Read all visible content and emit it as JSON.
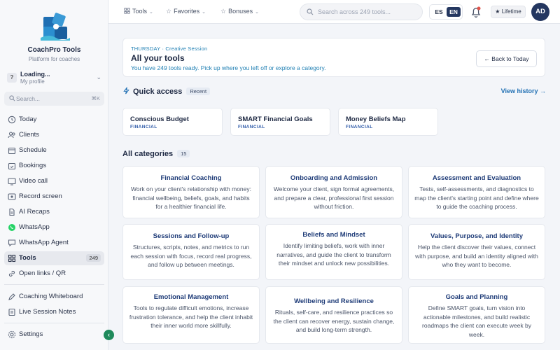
{
  "brand": {
    "name": "CoachPro Tools",
    "tagline": "Platform for coaches"
  },
  "profile": {
    "badge": "?",
    "name": "Loading...",
    "sub": "My profile"
  },
  "sidebar_search": {
    "placeholder": "Search...",
    "shortcut": "⌘K"
  },
  "nav": [
    {
      "label": "Today",
      "icon": "clock-icon"
    },
    {
      "label": "Clients",
      "icon": "users-icon"
    },
    {
      "label": "Schedule",
      "icon": "calendar-icon"
    },
    {
      "label": "Bookings",
      "icon": "calendar-check-icon"
    },
    {
      "label": "Video call",
      "icon": "video-icon"
    },
    {
      "label": "Record screen",
      "icon": "record-icon"
    },
    {
      "label": "AI Recaps",
      "icon": "document-icon"
    },
    {
      "label": "WhatsApp",
      "icon": "whatsapp-icon"
    },
    {
      "label": "WhatsApp Agent",
      "icon": "chat-icon"
    },
    {
      "label": "Tools",
      "icon": "grid-icon",
      "count": "249",
      "active": true
    },
    {
      "label": "Open links / QR",
      "icon": "link-icon"
    },
    {
      "label": "Coaching Whiteboard",
      "icon": "pencil-icon"
    },
    {
      "label": "Live Session Notes",
      "icon": "notes-icon"
    },
    {
      "label": "Settings",
      "icon": "gear-icon"
    }
  ],
  "topbar": {
    "menus": [
      "Tools",
      "Favorites",
      "Bonuses"
    ],
    "search_placeholder": "Search across 249 tools...",
    "lang_es": "ES",
    "lang_en": "EN",
    "plan": "★ Lifetime",
    "avatar": "AD"
  },
  "hero": {
    "eyebrow": "THURSDAY · Creative Session",
    "title": "All your tools",
    "subtitle": "You have 249 tools ready. Pick up where you left off or explore a category.",
    "back_label": "← Back to Today"
  },
  "quick_access": {
    "title": "Quick access",
    "badge": "Recent",
    "view_history": "View history →",
    "items": [
      {
        "name": "Conscious Budget",
        "tag": "FINANCIAL"
      },
      {
        "name": "SMART Financial Goals",
        "tag": "FINANCIAL"
      },
      {
        "name": "Money Beliefs Map",
        "tag": "FINANCIAL"
      }
    ]
  },
  "categories": {
    "title": "All categories",
    "count": "15",
    "items": [
      {
        "title": "Financial Coaching",
        "desc": "Work on your client's relationship with money: financial wellbeing, beliefs, goals, and habits for a healthier financial life."
      },
      {
        "title": "Onboarding and Admission",
        "desc": "Welcome your client, sign formal agreements, and prepare a clear, professional first session without friction."
      },
      {
        "title": "Assessment and Evaluation",
        "desc": "Tests, self-assessments, and diagnostics to map the client's starting point and define where to guide the coaching process."
      },
      {
        "title": "Sessions and Follow-up",
        "desc": "Structures, scripts, notes, and metrics to run each session with focus, record real progress, and follow up between meetings."
      },
      {
        "title": "Beliefs and Mindset",
        "desc": "Identify limiting beliefs, work with inner narratives, and guide the client to transform their mindset and unlock new possibilities."
      },
      {
        "title": "Values, Purpose, and Identity",
        "desc": "Help the client discover their values, connect with purpose, and build an identity aligned with who they want to become."
      },
      {
        "title": "Emotional Management",
        "desc": "Tools to regulate difficult emotions, increase frustration tolerance, and help the client inhabit their inner world more skillfully."
      },
      {
        "title": "Wellbeing and Resilience",
        "desc": "Rituals, self-care, and resilience practices so the client can recover energy, sustain change, and build long-term strength."
      },
      {
        "title": "Goals and Planning",
        "desc": "Define SMART goals, turn vision into actionable milestones, and build realistic roadmaps the client can execute week by week."
      }
    ]
  },
  "colors": {
    "accent": "#243760",
    "link": "#1f7fb3",
    "active_nav": "#e7e9ee",
    "whatsapp": "#25d366"
  }
}
